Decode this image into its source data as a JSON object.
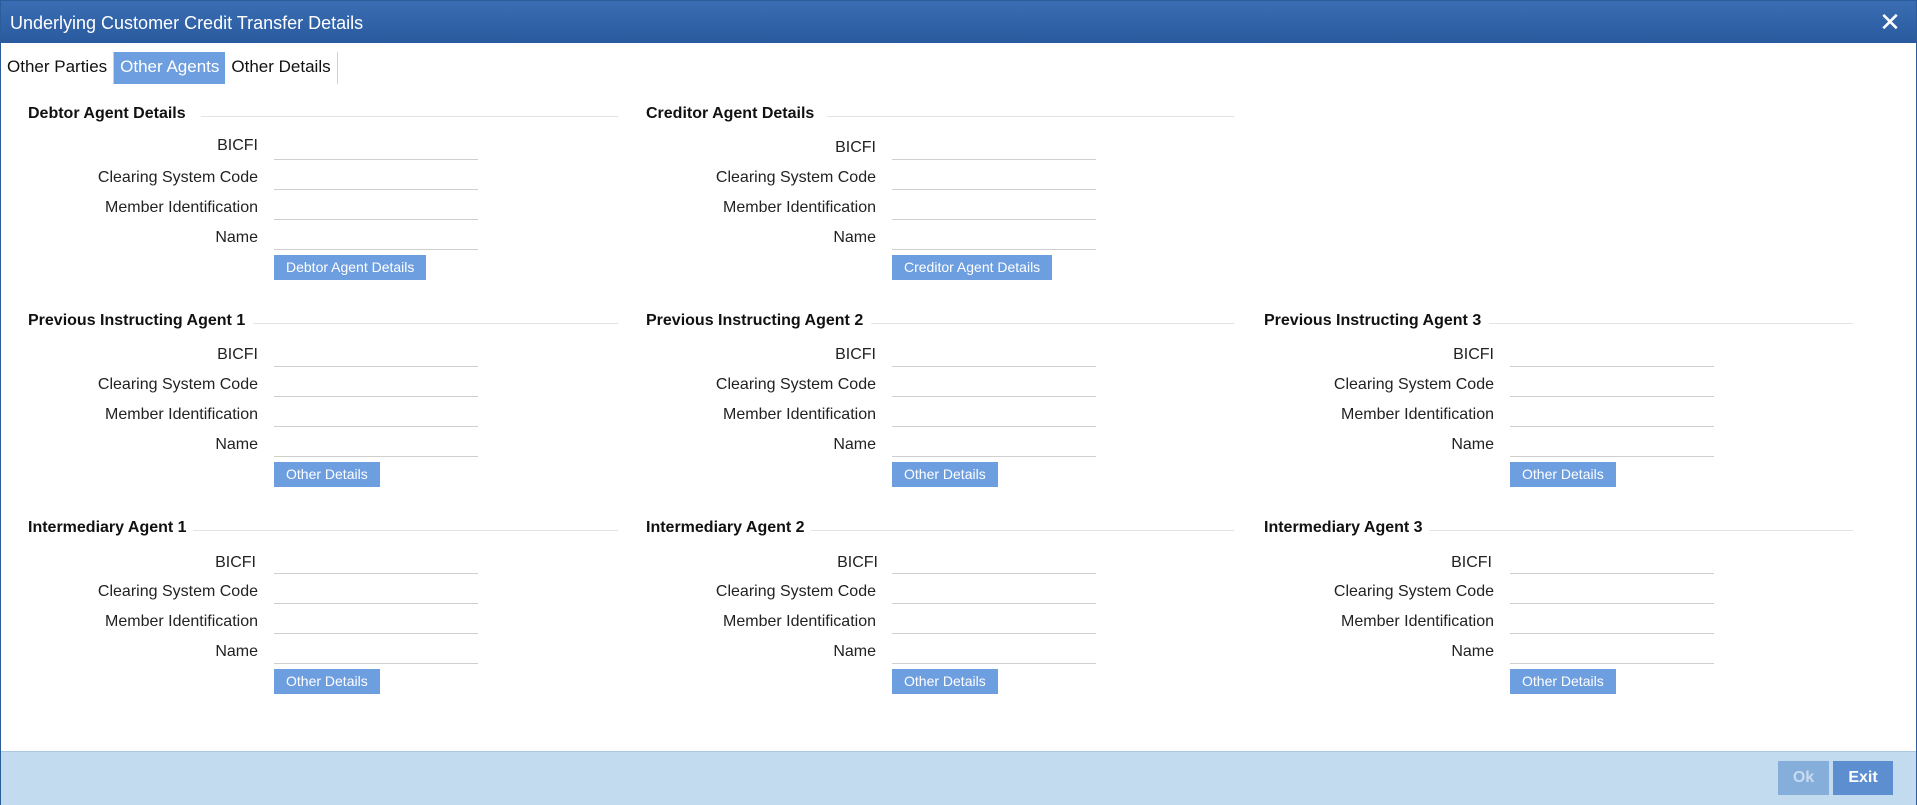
{
  "window": {
    "title": "Underlying Customer Credit Transfer Details",
    "close_icon": "close-icon",
    "close_symbol": "✕"
  },
  "tabs": [
    {
      "label": "Other Parties",
      "active": false
    },
    {
      "label": "Other Agents",
      "active": true
    },
    {
      "label": "Other Details",
      "active": false
    }
  ],
  "field_labels": {
    "bicfi": "BICFI",
    "clearing": "Clearing System Code",
    "member": "Member Identification",
    "name": "Name"
  },
  "sections": {
    "debtor_agent": {
      "title": "Debtor Agent Details",
      "button": "Debtor Agent Details"
    },
    "creditor_agent": {
      "title": "Creditor Agent Details",
      "button": "Creditor Agent Details"
    },
    "prev_agent_1": {
      "title": "Previous Instructing Agent 1",
      "button": "Other Details"
    },
    "prev_agent_2": {
      "title": "Previous Instructing Agent 2",
      "button": "Other Details"
    },
    "prev_agent_3": {
      "title": "Previous Instructing Agent 3",
      "button": "Other Details"
    },
    "inter_agent_1": {
      "title": "Intermediary Agent 1",
      "button": "Other Details"
    },
    "inter_agent_2": {
      "title": "Intermediary Agent 2",
      "button": "Other Details"
    },
    "inter_agent_3": {
      "title": "Intermediary Agent 3",
      "button": "Other Details"
    }
  },
  "footer": {
    "ok_label": "Ok",
    "exit_label": "Exit"
  },
  "colors": {
    "titlebar": "#2f62a8",
    "accent": "#6d9ee0",
    "footer": "#c2dbef"
  }
}
